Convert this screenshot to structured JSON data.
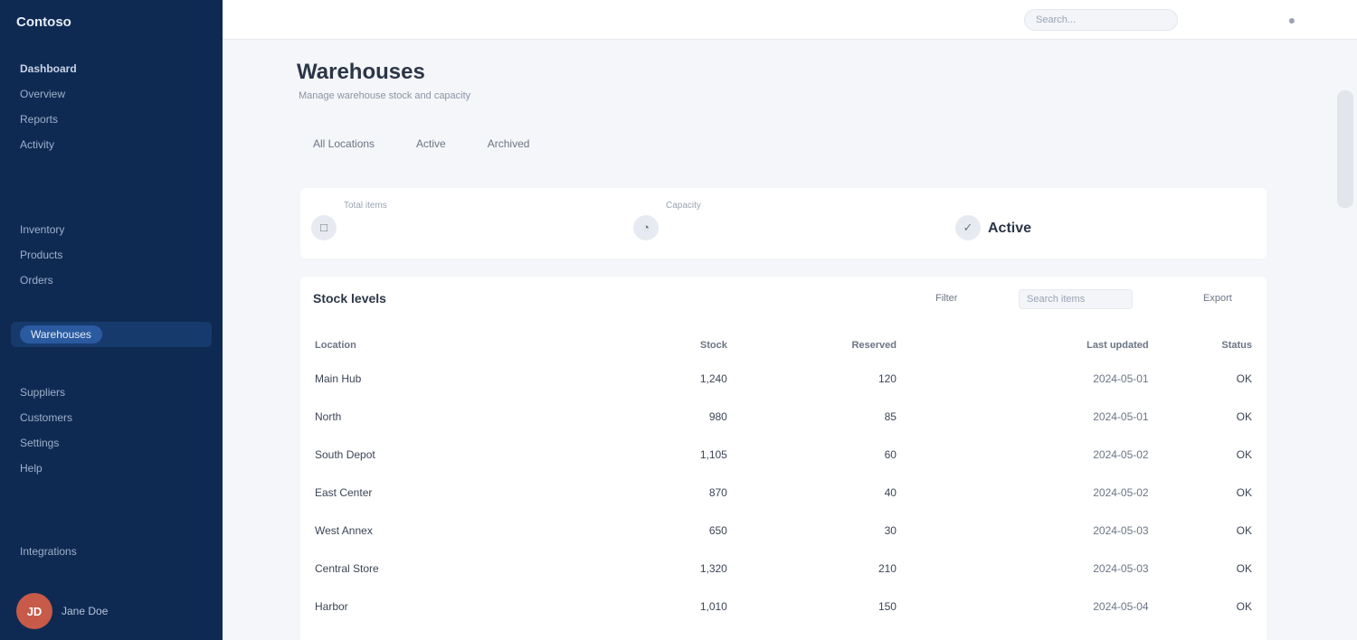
{
  "brand": "Contoso",
  "sidebar": {
    "groups": [
      [
        "Dashboard",
        "Overview",
        "Reports",
        "Activity"
      ],
      [
        "Inventory",
        "Products",
        "Orders"
      ],
      [
        "Warehouses"
      ],
      [
        "Suppliers",
        "Customers",
        "Settings",
        "Help"
      ],
      [
        "Integrations"
      ]
    ],
    "active": "Warehouses"
  },
  "user": {
    "initials": "JD",
    "name": "Jane Doe"
  },
  "topbar": {
    "search_placeholder": "Search...",
    "icon": "bell-icon"
  },
  "page": {
    "title": "Warehouses",
    "subtitle": "Manage warehouse stock and capacity"
  },
  "tabs": [
    "All Locations",
    "Active",
    "Archived"
  ],
  "stats": [
    {
      "label": "Total items",
      "value": "",
      "icon": "box-icon"
    },
    {
      "label": "Capacity",
      "value": "",
      "icon": "gauge-icon"
    },
    {
      "label": "",
      "value": "Active",
      "icon": "check-icon"
    }
  ],
  "table": {
    "title": "Stock levels",
    "buttons": {
      "filter": "Filter",
      "search": "Search items",
      "export": "Export"
    },
    "headers": [
      "Location",
      "Stock",
      "Reserved",
      "Last updated",
      "Status"
    ],
    "rows": [
      [
        "Main Hub",
        "1,240",
        "120",
        "2024-05-01",
        "OK"
      ],
      [
        "North",
        "980",
        "85",
        "2024-05-01",
        "OK"
      ],
      [
        "South Depot",
        "1,105",
        "60",
        "2024-05-02",
        "OK"
      ],
      [
        "East Center",
        "870",
        "40",
        "2024-05-02",
        "OK"
      ],
      [
        "West Annex",
        "650",
        "30",
        "2024-05-03",
        "OK"
      ],
      [
        "Central Store",
        "1,320",
        "210",
        "2024-05-03",
        "OK"
      ],
      [
        "Harbor",
        "1,010",
        "150",
        "2024-05-04",
        "OK"
      ]
    ]
  }
}
